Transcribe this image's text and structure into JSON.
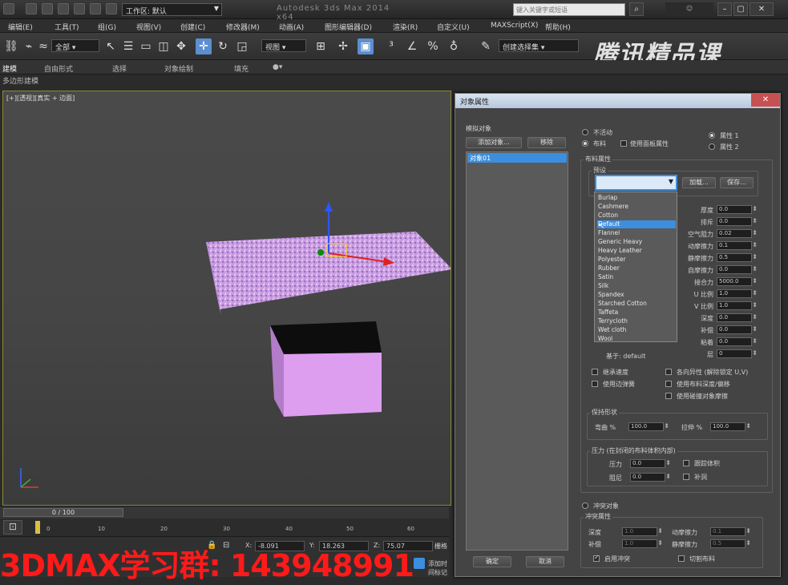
{
  "titlebar": {
    "workspace": "工作区: 默认",
    "app_title": "Autodesk 3ds Max 2014 x64",
    "search_placeholder": "键入关键字或短语",
    "min_label": "–",
    "max_label": "▢",
    "close_label": "✕"
  },
  "menubar": {
    "items": [
      "编辑(E)",
      "工具(T)",
      "组(G)",
      "视图(V)",
      "创建(C)",
      "修改器(M)",
      "动画(A)",
      "图形编辑器(D)",
      "渲染(R)",
      "自定义(U)",
      "MAXScript(X)",
      "帮助(H)"
    ]
  },
  "toolbar": {
    "selection_filter": "全部",
    "ref_coord": "视图",
    "named_selection": "创建选择集"
  },
  "ribbon": {
    "tabs": [
      "建模",
      "自由形式",
      "选择",
      "对象绘制",
      "填充"
    ],
    "sub_label": "多边形建模"
  },
  "viewport": {
    "label": "[+][透视][真实 + 边面]"
  },
  "watermark_logo": "腾讯精品课",
  "timeline": {
    "slider": "0 / 100",
    "ticks": [
      "0",
      "10",
      "20",
      "30",
      "40",
      "50",
      "60"
    ]
  },
  "status": {
    "x": "-8.091",
    "y": "18.263",
    "z": "75.07",
    "grid": "栅格",
    "add_time_tag": "添加时间标记"
  },
  "watermark_text": "3DMAX学习群: 143948991",
  "dialog": {
    "title": "对象属性",
    "close_label": "✕",
    "sim_objects_label": "模拟对象",
    "add_objects_button": "添加对象...",
    "remove_button": "移除",
    "object_item": "对象01",
    "radio_inactive": "不活动",
    "radio_cloth": "布料",
    "use_panel_props": "使用面板属性",
    "prop1": "属性 1",
    "prop2": "属性 2",
    "cloth_props_label": "布料属性",
    "preset_label": "预设",
    "load_button": "加载...",
    "save_button": "保存...",
    "preset_value": "",
    "preset_options": [
      "Burlap",
      "Cashmere",
      "Cotton",
      "Default",
      "Flannel",
      "Generic Heavy",
      "Heavy Leather",
      "Polyester",
      "Rubber",
      "Satin",
      "Silk",
      "Spandex",
      "Starched Cotton",
      "Taffeta",
      "Terrycloth",
      "Wet cloth",
      "Wool"
    ],
    "param_labels": [
      "厚度",
      "排斥",
      "空气阻力",
      "动摩擦力",
      "静摩擦力",
      "自摩擦力",
      "接合力",
      "U 比例",
      "V 比例",
      "深度",
      "补偿",
      "粘着",
      "层"
    ],
    "param_values": [
      "0.0",
      "0.0",
      "0.02",
      "0.1",
      "0.5",
      "0.0",
      "5000.0",
      "1.0",
      "1.0",
      "0.0",
      "0.0",
      "0.0",
      "0"
    ],
    "based_on": "基于: default",
    "plasticity": "继承速度",
    "anisotropic": "各向异性 (解除锁定 U,V)",
    "use_edge_springs": "使用边弹簧",
    "use_cloth_depth": "使用布料深度/偏移",
    "use_collision_friction": "使用碰撞对象摩擦",
    "keep_shape_label": "保持形状",
    "bend_pct_label": "弯曲 %",
    "bend_pct_value": "100.0",
    "stretch_pct_label": "拉伸 %",
    "stretch_pct_value": "100.0",
    "pressure_label": "压力 (在封闭的布料体积内部)",
    "pressure": "压力",
    "pressure_value": "0.0",
    "damping": "阻尼",
    "damping_value": "0.0",
    "track_volume": "跟踪体积",
    "cap_holes": "补洞",
    "collision_objects": "冲突对象",
    "collision_props_label": "冲突属性",
    "depth_label": "深度",
    "depth_value": "1.0",
    "offset_label": "补偿",
    "offset_value": "1.0",
    "dyn_friction_label": "动摩擦力",
    "dyn_friction_value": "0.1",
    "static_friction_label": "静摩擦力",
    "static_friction_value": "0.5",
    "enable_collisions": "启用冲突",
    "cut_cloth": "切割布料",
    "ok_button": "确定",
    "cancel_button": "取消"
  }
}
